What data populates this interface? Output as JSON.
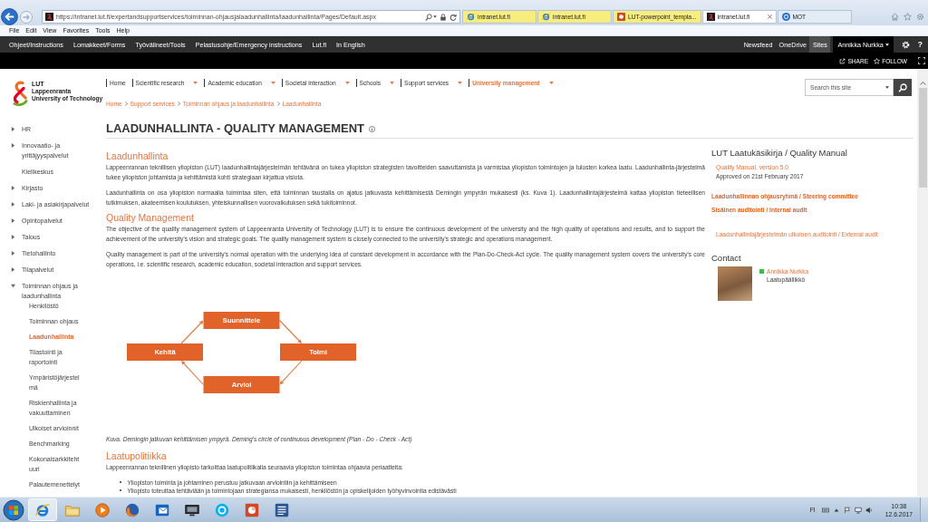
{
  "browser": {
    "address": "https://intranet.lut.fi/expertandsupportservices/toiminnan-ohjausjalaadunhallinta/laadunhallinta/Pages/Default.aspx",
    "tabs": [
      {
        "title": "intranet.lut.fi",
        "kind": "web",
        "color": "#f7ec7e",
        "selected": false
      },
      {
        "title": "intranet.lut.fi",
        "kind": "web",
        "color": "#f7ec7e",
        "selected": false
      },
      {
        "title": "LUT-powerpoint_templa...",
        "kind": "slides",
        "color": "#f7ec7e",
        "selected": false
      },
      {
        "title": "intranet.lut.fi",
        "kind": "site",
        "selected": true
      },
      {
        "title": "MOT",
        "kind": "dictionary",
        "selected": false
      }
    ],
    "menu": [
      "File",
      "Edit",
      "View",
      "Favorites",
      "Tools",
      "Help"
    ]
  },
  "suite_bar": {
    "links": [
      "Ohjeet/Instructions",
      "Lomakkeet/Forms",
      "Työvälineet/Tools",
      "Pelastusohje/Emergency instructions",
      "Lut.fi",
      "In English"
    ],
    "right_links": [
      {
        "label": "Newsfeed",
        "selected": false
      },
      {
        "label": "OneDrive",
        "selected": false
      },
      {
        "label": "Sites",
        "selected": true
      }
    ],
    "user": "Annikka Nurkka",
    "help": "?"
  },
  "page_actions": [
    {
      "label": "SHARE",
      "kind": "share"
    },
    {
      "label": "FOLLOW",
      "kind": "follow"
    }
  ],
  "logo": {
    "title": "LUT",
    "lines": [
      "Lappeenranta",
      "University of Technology"
    ]
  },
  "top_nav": [
    {
      "label": "Home",
      "dropdown": false,
      "selected": false
    },
    {
      "label": "Scientific research",
      "dropdown": true,
      "selected": false
    },
    {
      "label": "Academic education",
      "dropdown": true,
      "selected": false
    },
    {
      "label": "Societal interaction",
      "dropdown": true,
      "selected": false
    },
    {
      "label": "Schools",
      "dropdown": true,
      "selected": false
    },
    {
      "label": "Support services",
      "dropdown": true,
      "selected": false
    },
    {
      "label": "University management",
      "dropdown": true,
      "selected": true
    }
  ],
  "search": {
    "placeholder": "Search this site"
  },
  "breadcrumb": [
    "Home",
    "Support services",
    "Toiminnan ohjaus ja laadunhallinta",
    "Laadunhallinta"
  ],
  "page_title": "LAADUNHALLINTA - QUALITY MANAGEMENT",
  "sidebar": {
    "items": [
      {
        "label": "HR",
        "kind": "folder",
        "expanded": false,
        "selected": false
      },
      {
        "label": "Innovaatio- ja yrittäjyyspalvelut",
        "kind": "folder",
        "expanded": false,
        "selected": false
      },
      {
        "label": "Kielikeskus",
        "kind": "page",
        "selected": false
      },
      {
        "label": "Kirjasto",
        "kind": "folder",
        "expanded": false,
        "selected": false
      },
      {
        "label": "Laki- ja asiakirjapalvelut",
        "kind": "folder",
        "expanded": false,
        "selected": false
      },
      {
        "label": "Opintopalvelut",
        "kind": "folder",
        "expanded": false,
        "selected": false
      },
      {
        "label": "Talous",
        "kind": "folder",
        "expanded": false,
        "selected": false
      },
      {
        "label": "Tietohallinto",
        "kind": "folder",
        "expanded": false,
        "selected": false
      },
      {
        "label": "Tilapalvelut",
        "kind": "folder",
        "expanded": false,
        "selected": false
      },
      {
        "label": "Toiminnan ohjaus ja laadunhallinta",
        "kind": "folder",
        "expanded": true,
        "selected": false,
        "children": [
          {
            "label": "Henkilöstö",
            "selected": false
          },
          {
            "label": "Toiminnan ohjaus",
            "selected": false
          },
          {
            "label": "Laadunhallinta",
            "selected": true
          },
          {
            "label": "Tilastointi ja raportointi",
            "selected": false
          },
          {
            "label": "Ympäristöjärjestelmä",
            "selected": false
          },
          {
            "label": "Riskienhallinta ja vakuuttaminen",
            "selected": false
          },
          {
            "label": "Ulkoiset arvioinnit",
            "selected": false
          },
          {
            "label": "Benchmarking",
            "selected": false
          },
          {
            "label": "Kokonaisarkkitehtuuri",
            "selected": false
          },
          {
            "label": "Palautemenettelyt",
            "selected": false
          }
        ]
      }
    ]
  },
  "content": [
    {
      "kind": "heading",
      "text": "Laadunhallinta"
    },
    {
      "kind": "paragraph",
      "text": "Lappeenrannan teknillisen yliopiston (LUT) laadunhallintajärjestelmän tehtävänä on tukea yliopiston strategisten tavoitteiden saavuttamista ja varmistaa yliopiston toimintojen ja tulosten korkea laatu. Laadunhallinta-järjestelmä tukee yliopiston johtamista ja kehittämistä kohti strategiaan kirjattua visiota."
    },
    {
      "kind": "paragraph",
      "text": "Laadunhallinta on osa yliopiston normaalia toimintaa siten, että toiminnan taustalla on ajatus jatkuvasta kehittämisestä Demingin ympyrän mukaisesti (ks. Kuva 1). Laadunhallintajärjestelmä kattaa yliopiston tieteellisen tutkimuksen, akateemisen koulutuksen, yhteiskunnallisen vuorovaikutuksen sekä tukitoiminnot."
    },
    {
      "kind": "heading",
      "text": "Quality Management"
    },
    {
      "kind": "paragraph",
      "text": "The objective of the quality management system of Lappeenranta University of Technology (LUT) is to ensure the continuous development of the university and the high quality of operations and results, and to support the achievement of the university's vision and strategic goals. The quality management system is closely connected to the university's strategic and operations management."
    },
    {
      "kind": "paragraph",
      "text": "Quality management is part of the university's normal operation with the underlying idea of constant development in accordance with the Plan-Do-Check-Act cycle. The quality management system covers the university's core operations, i.e. scientific research, academic education, societal interaction and support services."
    },
    {
      "kind": "diagram",
      "nodes": [
        "Suunnittele",
        "Toimi",
        "Arvioi",
        "Kehitä"
      ]
    },
    {
      "kind": "caption",
      "text": "Kuva. Demingin jatkuvan kehittämisen ympyrä. Deming's circle of continuous development (Plan - Do - Check - Act)"
    },
    {
      "kind": "heading",
      "text": "Laatupolitiikka"
    },
    {
      "kind": "paragraph",
      "text": "Lappeenrannan teknillinen yliopisto tarkoittaa laatupolitiikalla seuraavia yliopiston toimintaa ohjaavia periaatteita:"
    },
    {
      "kind": "list",
      "items": [
        "Yliopiston toiminta ja johtaminen perustuu jatkuvaan arviointiin ja kehittämiseen",
        "Yliopisto toteuttaa tehtäviään ja toimintojaan strategiansa mukaisesti, henkilöstön ja opiskelijoiden työhyvinvointia edistävästi"
      ]
    }
  ],
  "aside": {
    "title": "LUT Laatukäsikirja / Quality Manual",
    "items": [
      {
        "kind": "document",
        "label": "Quality Manual, version 5.0",
        "note": "Approved on 21st February 2017"
      },
      {
        "kind": "page",
        "label": "Laadunhallinnan ohjausryhmä / Steering committee"
      },
      {
        "kind": "page",
        "label": "Sisäinen auditointi / Internal audit"
      },
      {
        "kind": "document",
        "label": "Laadunhallintajärjestelmän ulkoinen auditointi / External audit"
      }
    ]
  },
  "contact": {
    "heading": "Contact",
    "name": "Annikka Nurkka",
    "role": "Laatupäällikkö",
    "online": true
  },
  "taskbar": {
    "apps": [
      {
        "kind": "browser",
        "selected": true
      },
      {
        "kind": "files",
        "selected": false
      },
      {
        "kind": "media",
        "selected": false
      },
      {
        "kind": "web",
        "selected": false
      },
      {
        "kind": "mail",
        "selected": false
      },
      {
        "kind": "network",
        "selected": false
      },
      {
        "kind": "chat",
        "selected": false
      },
      {
        "kind": "slides",
        "selected": false
      },
      {
        "kind": "document",
        "selected": false
      }
    ],
    "language": "FI",
    "time": "10:38",
    "date": "12.6.2017"
  }
}
